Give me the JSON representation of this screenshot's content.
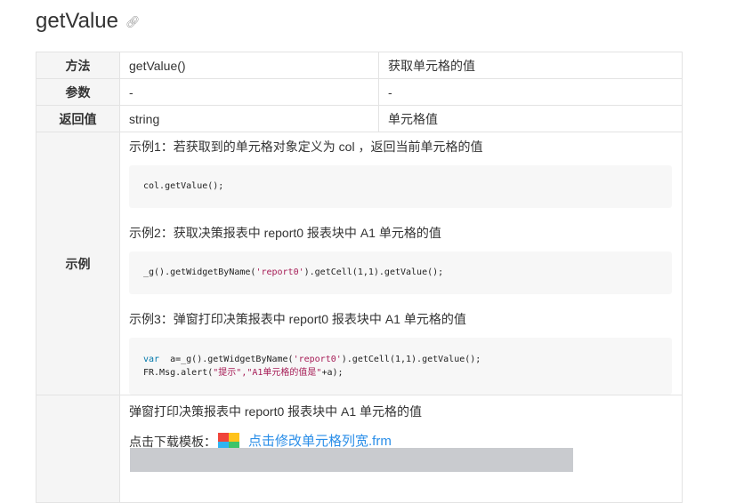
{
  "title": "getValue",
  "table": {
    "rows": [
      {
        "head": "方法",
        "col1": "getValue()",
        "col2": "获取单元格的值"
      },
      {
        "head": "参数",
        "col1": "-",
        "col2": "-"
      },
      {
        "head": "返回值",
        "col1": "string",
        "col2": "单元格值"
      }
    ],
    "examples_head": "示例",
    "examples": [
      {
        "label": "示例1：若获取到的单元格对象定义为 col ，返回当前单元格的值"
      },
      {
        "label": "示例2：获取决策报表中 report0 报表块中 A1 单元格的值"
      },
      {
        "label": "示例3：弹窗打印决策报表中 report0 报表块中 A1 单元格的值"
      }
    ],
    "code": {
      "c1": "col.getValue();",
      "c2_pre": "_g().getWidgetByName(",
      "c2_str": "'report0'",
      "c2_post": ").getCell(1,1).getValue();",
      "c3_kw": "var",
      "c3_a": "  a=_g().getWidgetByName(",
      "c3_str": "'report0'",
      "c3_b": ").getCell(1,1).getValue();",
      "c3_line2_pre": "FR.Msg.alert(",
      "c3_line2_str": "\"提示\",\"A1单元格的值是\"",
      "c3_line2_post": "+a);"
    },
    "tip": {
      "text": "弹窗打印决策报表中 report0 报表块中 A1 单元格的值",
      "download_label": "点击下载模板：",
      "download_link": "点击修改单元格列宽.frm"
    }
  },
  "colors": {
    "link": "#2a8ee8",
    "keyword": "#0077aa",
    "string": "#a61c56",
    "header_bg": "#f5f5f5",
    "code_bg": "#f7f7f7"
  }
}
